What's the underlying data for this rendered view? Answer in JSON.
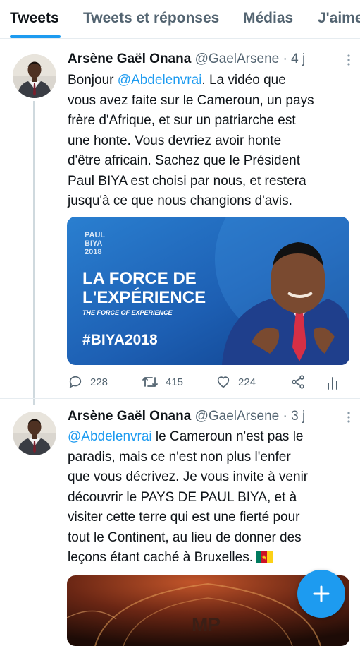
{
  "tabs": [
    "Tweets",
    "Tweets et réponses",
    "Médias",
    "J'aime"
  ],
  "tweets": [
    {
      "name": "Arsène Gaël Onana",
      "handle": "@GaelArsene",
      "separator": "·",
      "time": "4 j",
      "text_lines": [
        [
          "Bonjour ",
          "@Abdelenvrai",
          ". La vidéo que"
        ],
        "vous avez faite sur le Cameroun, un pays",
        "frère d'Afrique, et sur un patriarche est",
        "une honte. Vous devriez avoir honte",
        "d'être africain. Sachez que le Président",
        "Paul BIYA est choisi par nous, et restera",
        "jusqu'à ce que nous changions d'avis."
      ],
      "image": {
        "logo_lines": [
          "PAUL",
          "BIYA",
          "2018"
        ],
        "headline_1": "LA FORCE DE",
        "headline_2": "L'EXPÉRIENCE",
        "subline": "THE FORCE OF EXPERIENCE",
        "hashtag": "#BIYA2018"
      },
      "replies": "228",
      "retweets": "415",
      "likes": "224"
    },
    {
      "name": "Arsène Gaël Onana",
      "handle": "@GaelArsene",
      "separator": "·",
      "time": "3 j",
      "text_lines": [
        [
          "",
          "@Abdelenvrai",
          " le Cameroun n'est pas le"
        ],
        "paradis, mais ce n'est non plus l'enfer",
        "que vous décrivez. Je vous invite à venir",
        "découvrir le PAYS DE PAUL BIYA, et à",
        "visiter cette terre qui est une fierté pour",
        "tout le Continent, au lieu de donner des",
        "leçons étant caché à Bruxelles."
      ],
      "image": {
        "watermark": "MP"
      }
    }
  ],
  "colors": {
    "accent": "#1d9bf0",
    "muted": "#536471",
    "banner_blue": "#1e5fb0",
    "flag_green": "#007a5e",
    "flag_red": "#ce1126",
    "flag_yellow": "#fcd116"
  }
}
